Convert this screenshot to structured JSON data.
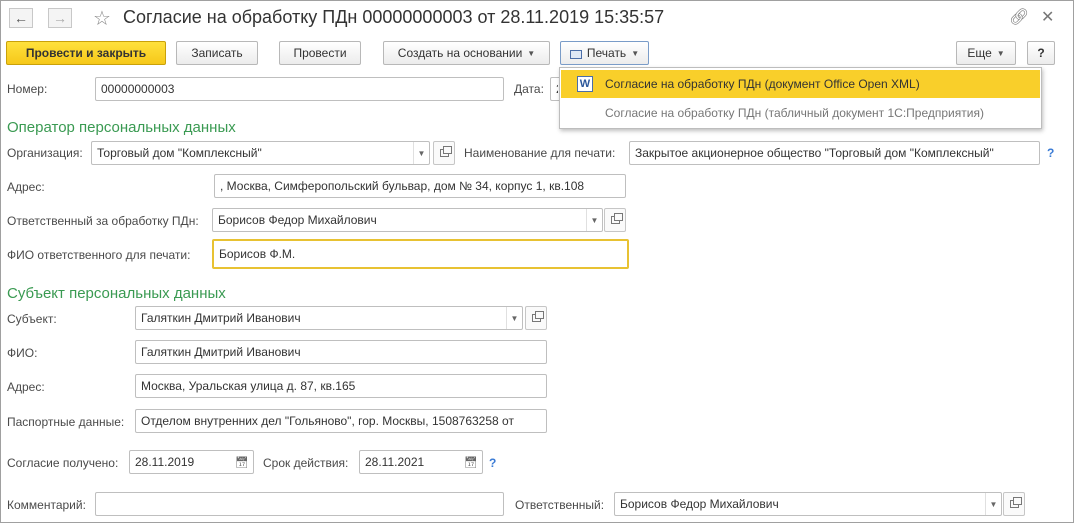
{
  "window": {
    "title": "Согласие на обработку ПДн 00000000003 от 28.11.2019 15:35:57"
  },
  "toolbar": {
    "post_and_close": "Провести и закрыть",
    "save": "Записать",
    "post": "Провести",
    "create_based_on": "Создать на основании",
    "print": "Печать",
    "more": "Еще",
    "help": "?"
  },
  "print_menu": {
    "items": [
      {
        "label": "Согласие на обработку ПДн (документ Office Open XML)"
      },
      {
        "label": "Согласие на обработку ПДн (табличный документ 1С:Предприятия)"
      }
    ]
  },
  "header": {
    "number_label": "Номер:",
    "number_value": "00000000003",
    "date_label": "Дата:",
    "date_value": "2"
  },
  "operator": {
    "section_title": "Оператор персональных данных",
    "org_label": "Организация:",
    "org_value": "Торговый дом \"Комплексный\"",
    "print_name_label": "Наименование для печати:",
    "print_name_value": "Закрытое акционерное общество \"Торговый дом \"Комплексный\"",
    "address_label": "Адрес:",
    "address_value": ", Москва, Симферопольский бульвар, дом № 34, корпус 1, кв.108",
    "responsible_label": "Ответственный за обработку ПДн:",
    "responsible_value": "Борисов Федор Михайлович",
    "responsible_print_label": "ФИО ответственного для печати:",
    "responsible_print_value": "Борисов Ф.М."
  },
  "subject": {
    "section_title": "Субъект персональных данных",
    "subject_label": "Субъект:",
    "subject_value": "Галяткин Дмитрий Иванович",
    "fio_label": "ФИО:",
    "fio_value": "Галяткин Дмитрий Иванович",
    "address_label": "Адрес:",
    "address_value": "Москва, Уральская улица д. 87, кв.165",
    "passport_label": "Паспортные данные:",
    "passport_value": "Отделом внутренних дел \"Гольяново\", гор. Москвы, 1508763258 от"
  },
  "consent": {
    "received_label": "Согласие получено:",
    "received_value": "28.11.2019",
    "valid_label": "Срок действия:",
    "valid_value": "28.11.2021",
    "help": "?"
  },
  "footer": {
    "comment_label": "Комментарий:",
    "comment_value": "",
    "responsible_label": "Ответственный:",
    "responsible_value": "Борисов Федор Михайлович"
  },
  "icons": {
    "back": "arrow-left",
    "forward": "arrow-right",
    "favorite": "star",
    "link": "link",
    "close": "close",
    "print": "printer",
    "word": "W",
    "calendar": "calendar"
  }
}
